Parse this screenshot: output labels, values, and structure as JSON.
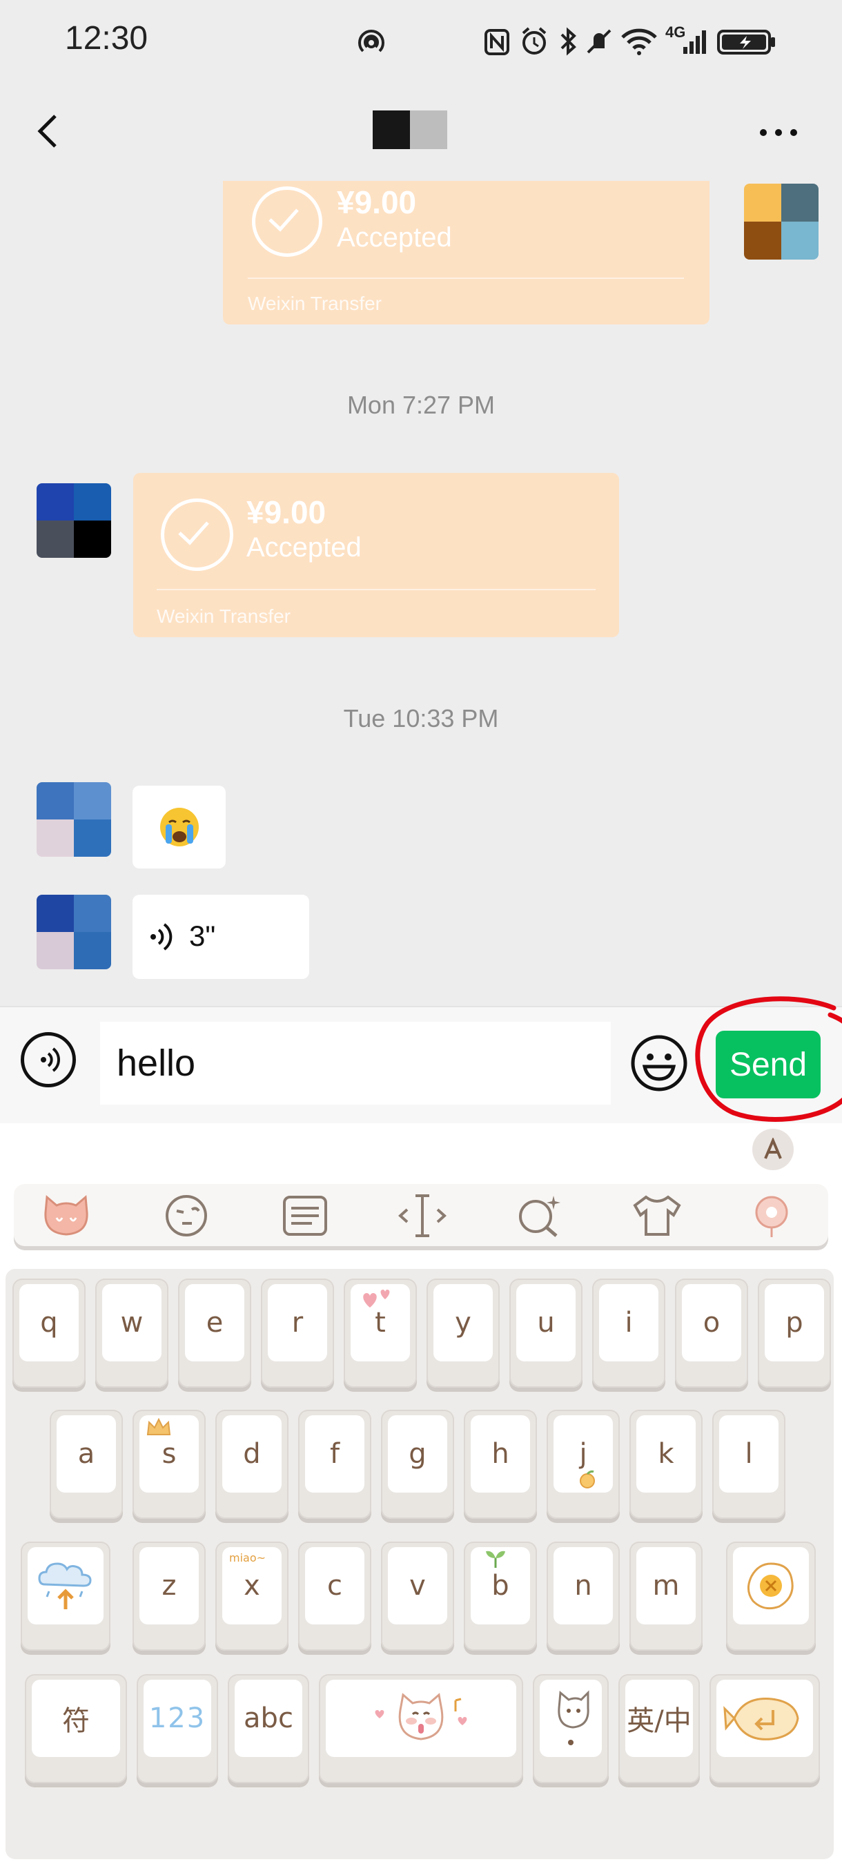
{
  "status_bar": {
    "time": "12:30",
    "icons": [
      "hotspot-icon",
      "nfc-icon",
      "alarm-icon",
      "bluetooth-icon",
      "mute-icon",
      "wifi-icon",
      "signal-4g-icon",
      "battery-charging-icon"
    ],
    "network_label": "4G"
  },
  "header": {
    "back_icon": "chevron-left-icon",
    "more_icon": "more-dots-icon"
  },
  "chat": {
    "messages": [
      {
        "type": "transfer",
        "side": "right",
        "amount": "¥9.00",
        "status": "Accepted",
        "brand": "Weixin Transfer"
      },
      {
        "type": "timestamp",
        "text": "Mon 7:27 PM"
      },
      {
        "type": "transfer",
        "side": "left",
        "amount": "¥9.00",
        "status": "Accepted",
        "brand": "Weixin Transfer"
      },
      {
        "type": "timestamp",
        "text": "Tue 10:33 PM"
      },
      {
        "type": "emoji",
        "side": "left",
        "emoji": "😭"
      },
      {
        "type": "voice",
        "side": "left",
        "duration": "3\""
      }
    ]
  },
  "input_bar": {
    "voice_icon": "voice-input-icon",
    "text_value": "hello",
    "emoji_icon": "emoji-smile-icon",
    "send_label": "Send",
    "send_color": "#07c160",
    "annotation_color": "#e30613"
  },
  "keyboard": {
    "toolbar_icons": [
      "cat-logo-icon",
      "wink-face-icon",
      "keyboard-layout-icon",
      "cursor-icon",
      "search-sparkle-icon",
      "theme-shirt-icon",
      "flower-paw-icon"
    ],
    "rows": [
      [
        "q",
        "w",
        "e",
        "r",
        "t",
        "y",
        "u",
        "i",
        "o",
        "p"
      ],
      [
        "a",
        "s",
        "d",
        "f",
        "g",
        "h",
        "j",
        "k",
        "l"
      ],
      [
        "shift",
        "z",
        "x",
        "c",
        "v",
        "b",
        "n",
        "m",
        "delete"
      ],
      [
        "符",
        "123",
        "abc",
        "space",
        "punct",
        "英/中",
        "enter"
      ]
    ],
    "decorations": {
      "s": "crown",
      "x": "miao~",
      "b": "sprout",
      "t": "hearts",
      "j": "orange"
    },
    "labels": {
      "symbols": "符",
      "numbers": "123",
      "abc": "abc",
      "lang": "英/中",
      "x_note": "miao~"
    }
  }
}
